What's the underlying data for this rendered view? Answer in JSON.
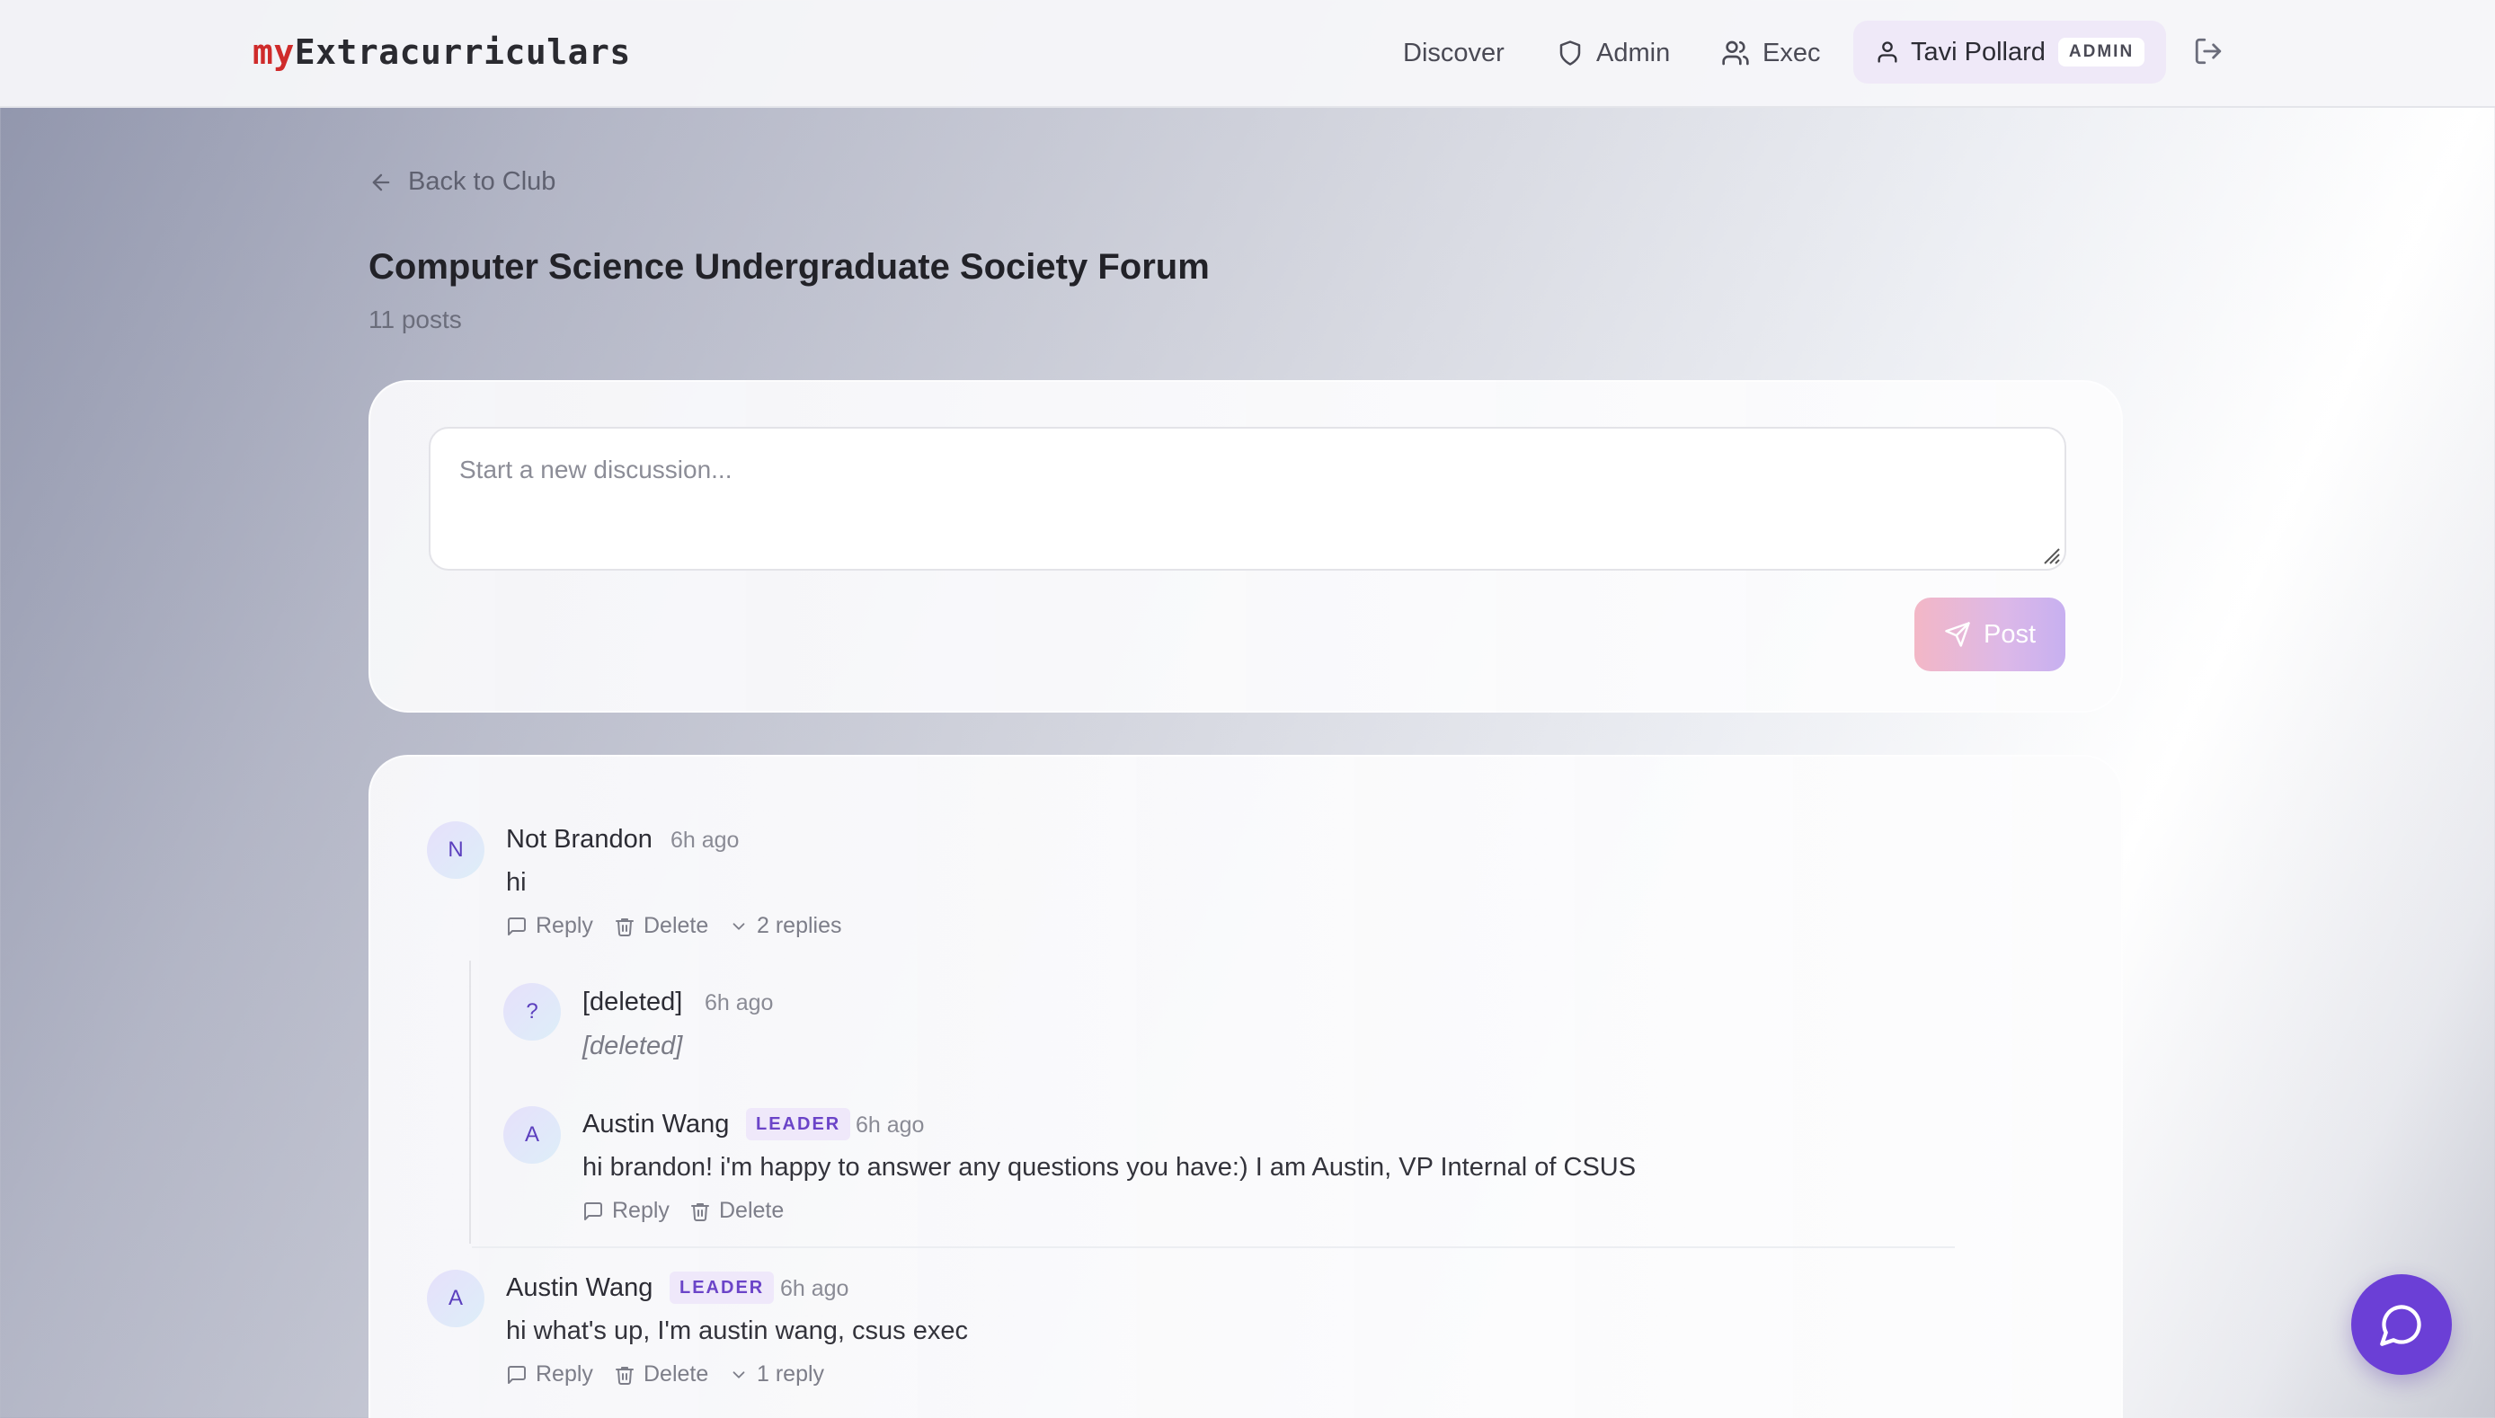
{
  "nav": {
    "logo_prefix": "my",
    "logo_rest": "Extracurriculars",
    "discover": "Discover",
    "admin": "Admin",
    "exec": "Exec",
    "user_name": "Tavi Pollard",
    "user_badge": "ADMIN"
  },
  "page": {
    "back_label": "Back to Club",
    "title": "Computer Science Undergraduate Society Forum",
    "post_count": "11 posts"
  },
  "composer": {
    "placeholder": "Start a new discussion...",
    "post_label": "Post"
  },
  "posts": [
    {
      "initial": "N",
      "author": "Not Brandon",
      "time": "6h ago",
      "body": "hi",
      "reply_label": "Reply",
      "delete_label": "Delete",
      "replies_label": "2 replies",
      "replies": [
        {
          "initial": "?",
          "author": "[deleted]",
          "time": "6h ago",
          "body": "[deleted]"
        },
        {
          "initial": "A",
          "author": "Austin Wang",
          "role": "LEADER",
          "time": "6h ago",
          "body": "hi brandon! i'm happy to answer any questions you have:) I am Austin, VP Internal of CSUS",
          "reply_label": "Reply",
          "delete_label": "Delete"
        }
      ]
    },
    {
      "initial": "A",
      "author": "Austin Wang",
      "role": "LEADER",
      "time": "6h ago",
      "body": "hi what's up, I'm austin wang, csus exec",
      "reply_label": "Reply",
      "delete_label": "Delete",
      "replies_label": "1 reply"
    }
  ],
  "colors": {
    "accent": "#6b3fd6",
    "logo_red": "#cf2b2b",
    "leader_badge": "#6b44c8"
  }
}
